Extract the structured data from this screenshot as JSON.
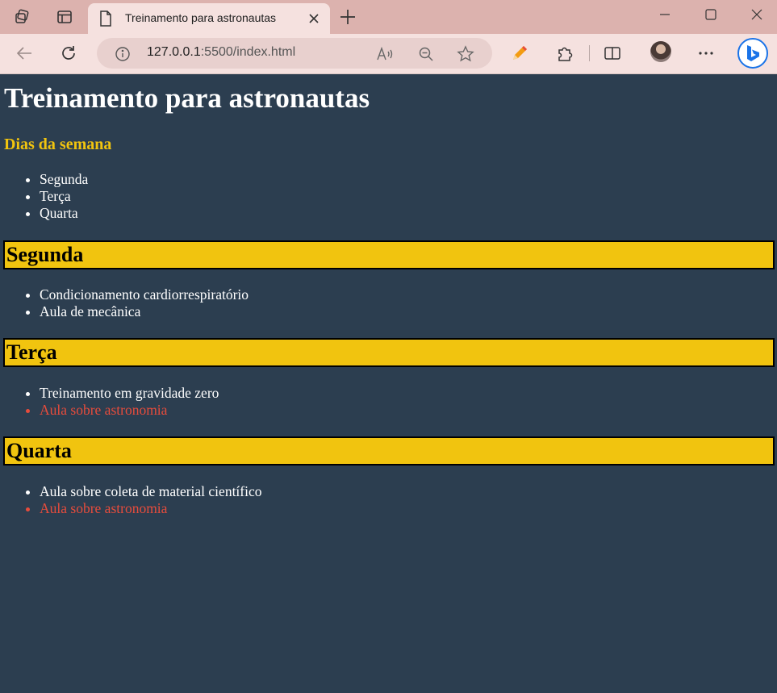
{
  "browser": {
    "tab_title": "Treinamento para astronautas",
    "address_host": "127.0.0.1",
    "address_rest": ":5500/index.html"
  },
  "page": {
    "title": "Treinamento para astronautas",
    "days_heading": "Dias da semana",
    "days_list": [
      "Segunda",
      "Terça",
      "Quarta"
    ],
    "sections": [
      {
        "heading": "Segunda",
        "items": [
          "Condicionamento cardiorrespiratório",
          "Aula de mecânica"
        ]
      },
      {
        "heading": "Terça",
        "items": [
          "Treinamento em gravidade zero",
          "Aula sobre astronomia"
        ]
      },
      {
        "heading": "Quarta",
        "items": [
          "Aula sobre coleta de material científico",
          "Aula sobre astronomia"
        ]
      }
    ]
  },
  "colors": {
    "background": "#2c3e50",
    "accent_yellow": "#f1c40f",
    "highlight_red": "#e74c3c",
    "text_white": "#ffffff"
  },
  "icons": [
    "workspaces-icon",
    "tab-actions-icon",
    "page-icon",
    "close-icon",
    "plus-icon",
    "minimize-icon",
    "maximize-icon",
    "window-close-icon",
    "back-icon",
    "refresh-icon",
    "info-icon",
    "read-aloud-icon",
    "zoom-out-icon",
    "favorite-star-icon",
    "pen-icon",
    "extensions-icon",
    "split-screen-icon",
    "profile-avatar",
    "more-icon",
    "bing-copilot-icon"
  ]
}
